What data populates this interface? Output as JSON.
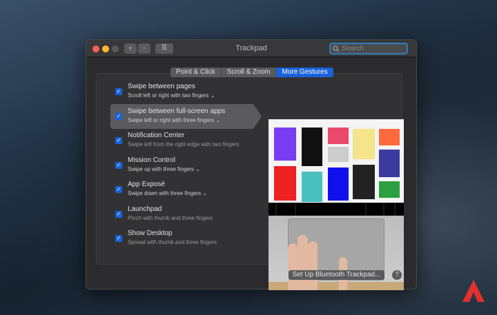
{
  "window": {
    "title": "Trackpad",
    "search_placeholder": "Search",
    "nav_back": "‹",
    "nav_forward": "›",
    "grid_icon": "⠿"
  },
  "tabs": [
    {
      "label": "Point & Click"
    },
    {
      "label": "Scroll & Zoom"
    },
    {
      "label": "More Gestures",
      "active": true
    }
  ],
  "gestures": [
    {
      "title": "Swipe between pages",
      "subtitle": "Scroll left or right with two fingers",
      "dropdown": true,
      "checked": true
    },
    {
      "title": "Swipe between full-screen apps",
      "subtitle": "Swipe left or right with three fingers",
      "dropdown": true,
      "checked": true,
      "selected": true
    },
    {
      "title": "Notification Center",
      "subtitle": "Swipe left from the right edge with two fingers",
      "dropdown": false,
      "checked": true
    },
    {
      "title": "Mission Control",
      "subtitle": "Swipe up with three fingers",
      "dropdown": true,
      "checked": true
    },
    {
      "title": "App Exposé",
      "subtitle": "Swipe down with three fingers",
      "dropdown": true,
      "checked": true
    },
    {
      "title": "Launchpad",
      "subtitle": "Pinch with thumb and three fingers",
      "dropdown": false,
      "checked": true
    },
    {
      "title": "Show Desktop",
      "subtitle": "Spread with thumb and three fingers",
      "dropdown": false,
      "checked": true
    }
  ],
  "footer": {
    "bluetooth_button": "Set Up Bluetooth Trackpad...",
    "help": "?"
  },
  "colors": {
    "accent": "#1a62d8",
    "close": "#fe5f57",
    "minimize": "#febc2e",
    "zoom_disabled": "#5a5a5c",
    "logo": "#e0322c"
  }
}
